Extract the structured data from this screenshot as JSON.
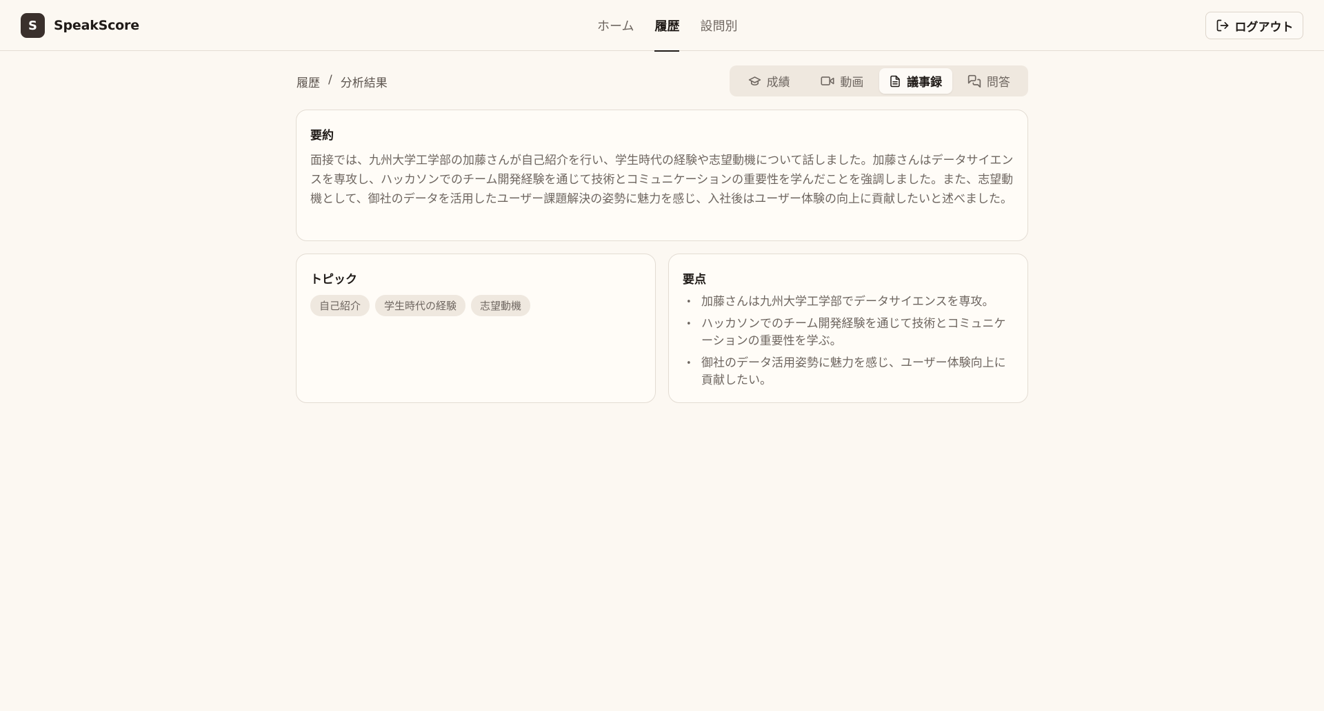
{
  "app": {
    "logo_letter": "S",
    "name": "SpeakScore"
  },
  "nav": {
    "items": [
      {
        "label": "ホーム"
      },
      {
        "label": "履歴"
      },
      {
        "label": "設問別"
      }
    ],
    "active": "履歴"
  },
  "header": {
    "logout_label": "ログアウト"
  },
  "breadcrumb": {
    "root": "履歴",
    "separator": "/",
    "current": "分析結果"
  },
  "tabs": [
    {
      "label": "成績",
      "icon": "graduation-cap-icon"
    },
    {
      "label": "動画",
      "icon": "video-icon"
    },
    {
      "label": "議事録",
      "icon": "document-icon"
    },
    {
      "label": "問答",
      "icon": "chat-icon"
    }
  ],
  "active_tab": "議事録",
  "summary": {
    "title": "要約",
    "text": "面接では、九州大学工学部の加藤さんが自己紹介を行い、学生時代の経験や志望動機について話しました。加藤さんはデータサイエンスを専攻し、ハッカソンでのチーム開発経験を通じて技術とコミュニケーションの重要性を学んだことを強調しました。また、志望動機として、御社のデータを活用したユーザー課題解決の姿勢に魅力を感じ、入社後はユーザー体験の向上に貢献したいと述べました。"
  },
  "topics": {
    "title": "トピック",
    "items": [
      "自己紹介",
      "学生時代の経験",
      "志望動機"
    ]
  },
  "points": {
    "title": "要点",
    "items": [
      "加藤さんは九州大学工学部でデータサイエンスを専攻。",
      "ハッカソンでのチーム開発経験を通じて技術とコミュニケーションの重要性を学ぶ。",
      "御社のデータ活用姿勢に魅力を感じ、ユーザー体験向上に貢献したい。"
    ]
  },
  "colors": {
    "background": "#fcf8f2",
    "brand": "#3a302c",
    "text": "#1f1a17",
    "muted": "#6e6660"
  }
}
